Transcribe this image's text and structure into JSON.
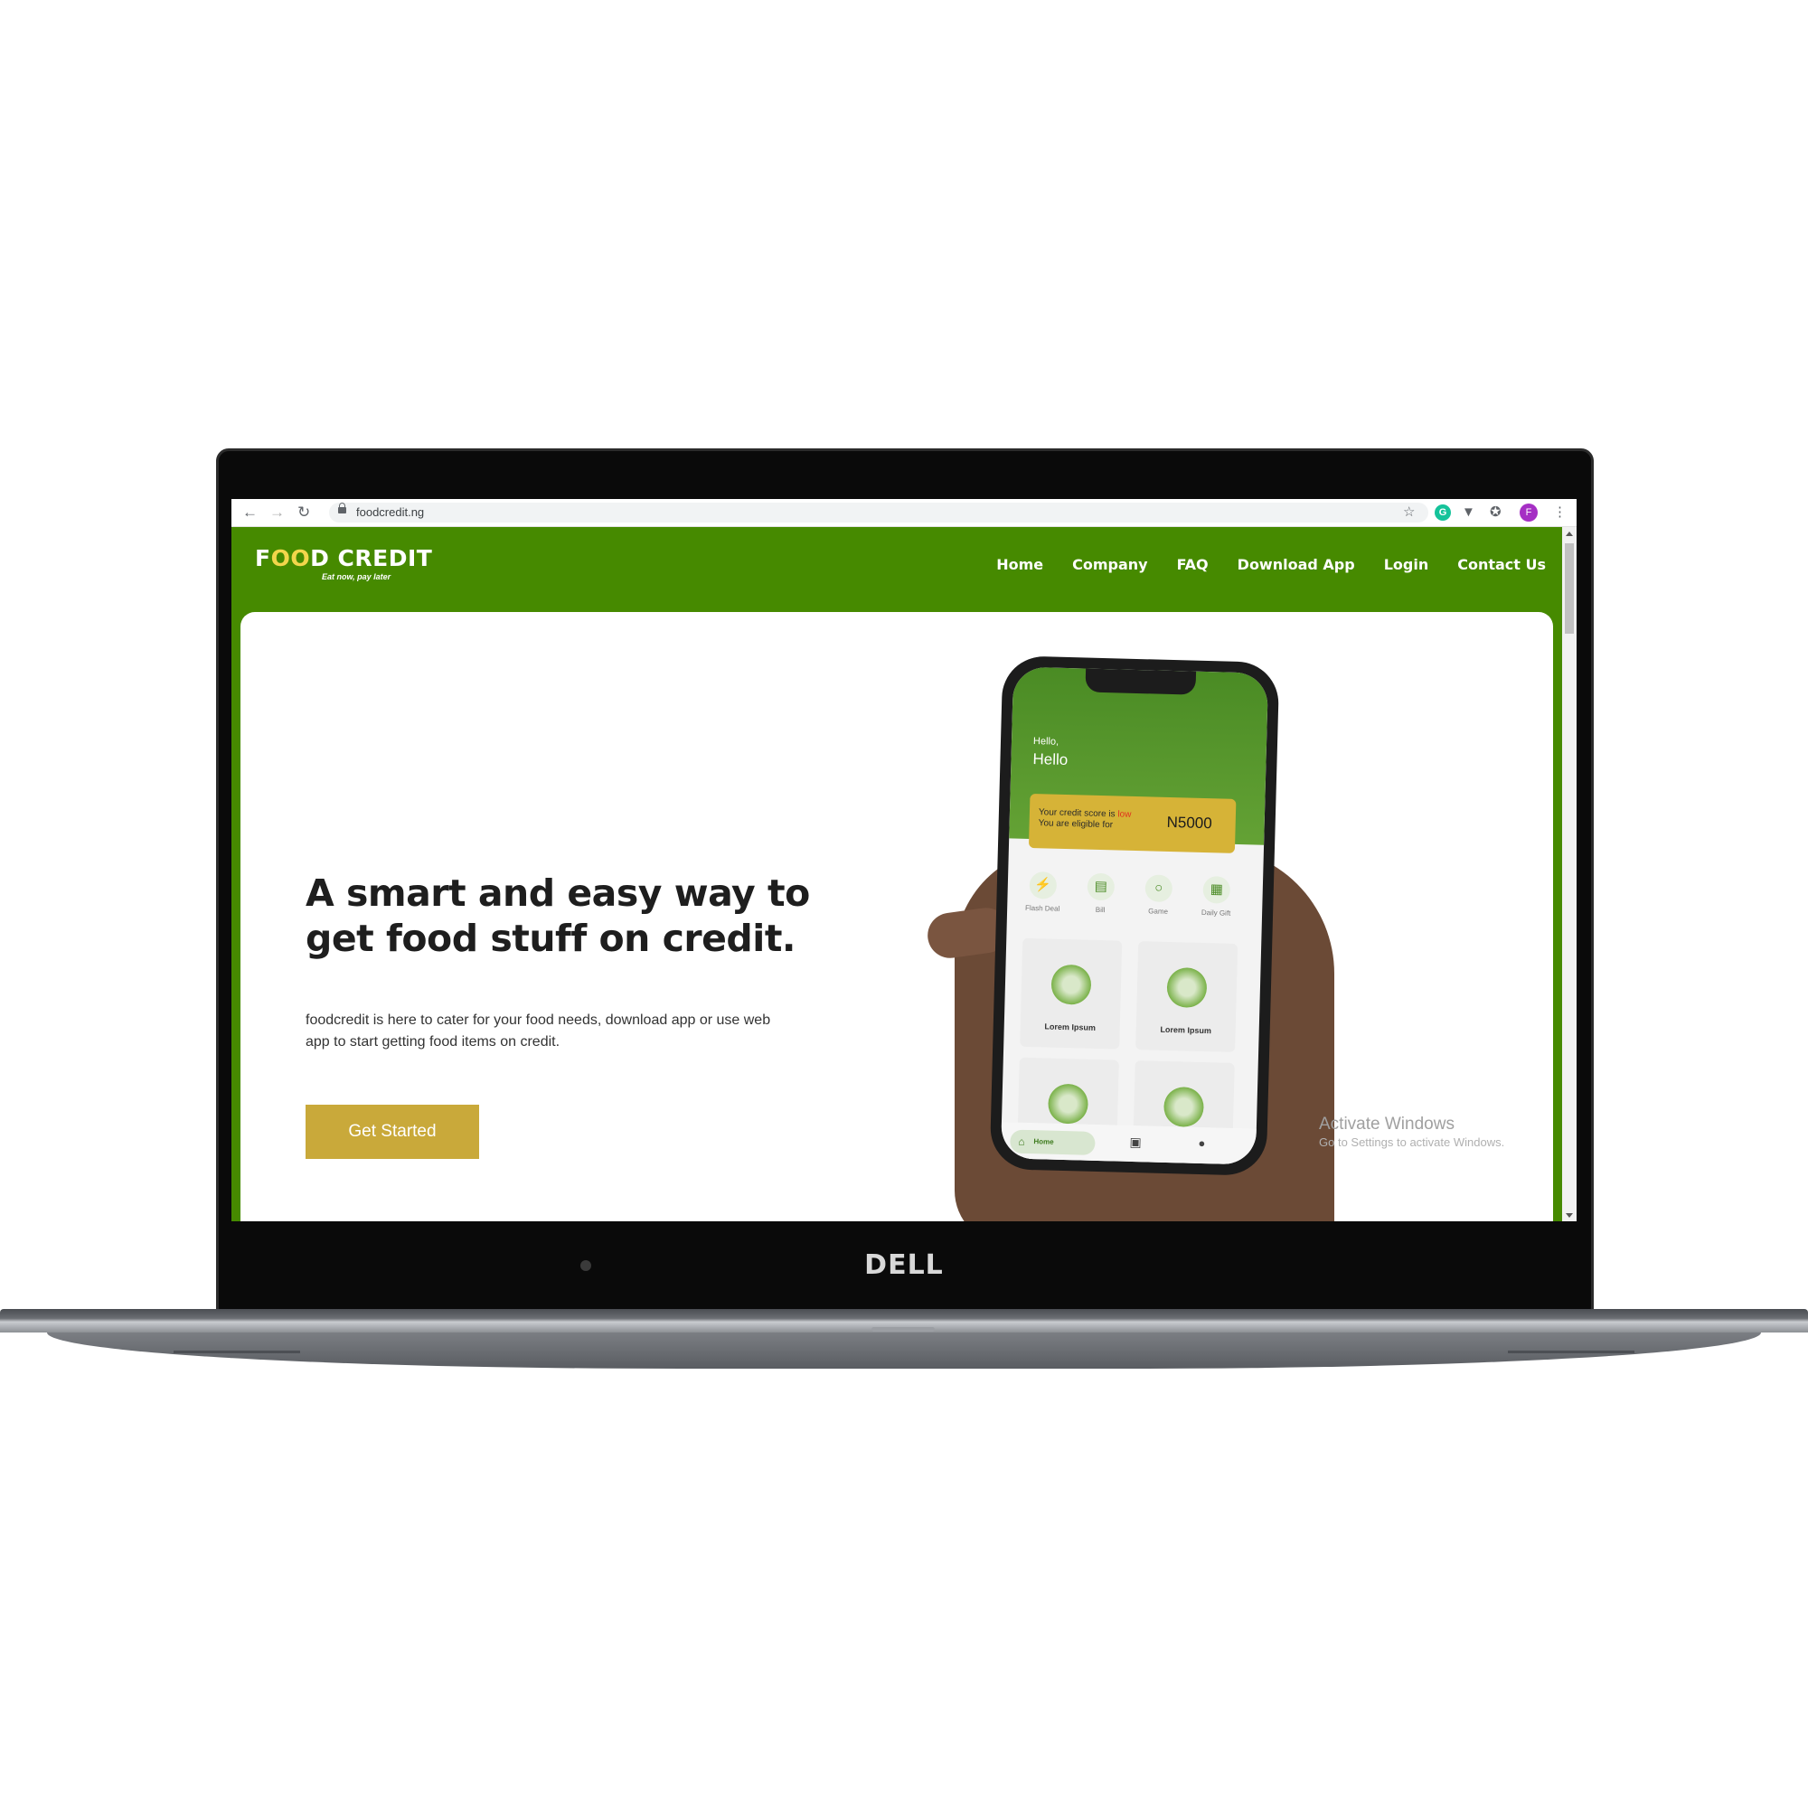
{
  "device": {
    "brand": "DELL"
  },
  "browser": {
    "url": "foodcredit.ng",
    "back_icon": "back-arrow-icon",
    "forward_icon": "forward-arrow-icon",
    "reload_icon": "reload-icon",
    "profile_initial": "F",
    "grammarly_initial": "G"
  },
  "site": {
    "logo": {
      "text_prefix": "F",
      "text_o": "OO",
      "text_suffix": "D CREDIT",
      "tagline": "Eat now, pay later"
    },
    "nav": [
      {
        "label": "Home"
      },
      {
        "label": "Company"
      },
      {
        "label": "FAQ"
      },
      {
        "label": "Download App"
      },
      {
        "label": "Login"
      },
      {
        "label": "Contact Us"
      }
    ],
    "hero": {
      "headline": "A smart and easy way to get food stuff on credit.",
      "subtext": "foodcredit is here to cater for your food needs, download app or use web app to start getting food items on credit.",
      "cta": "Get Started"
    },
    "phone": {
      "greeting_small": "Hello,",
      "greeting_name": "Hello",
      "credit_line1_prefix": "Your credit score is",
      "credit_status": "low",
      "credit_line2": "You are eligible for",
      "credit_amount": "N5000",
      "quick_actions": [
        {
          "label": "Flash Deal",
          "icon": "lightning-icon"
        },
        {
          "label": "Bill",
          "icon": "receipt-icon"
        },
        {
          "label": "Game",
          "icon": "gamepad-icon"
        },
        {
          "label": "Daily Gift",
          "icon": "gift-icon"
        }
      ],
      "products": [
        {
          "label": "Lorem Ipsum"
        },
        {
          "label": "Lorem Ipsum"
        },
        {
          "label": ""
        },
        {
          "label": ""
        }
      ],
      "tab_home": "Home"
    },
    "watermark": {
      "line1": "Activate Windows",
      "line2": "Go to Settings to activate Windows."
    }
  },
  "colors": {
    "brand_green": "#468a00",
    "accent_gold": "#c9a93a"
  }
}
